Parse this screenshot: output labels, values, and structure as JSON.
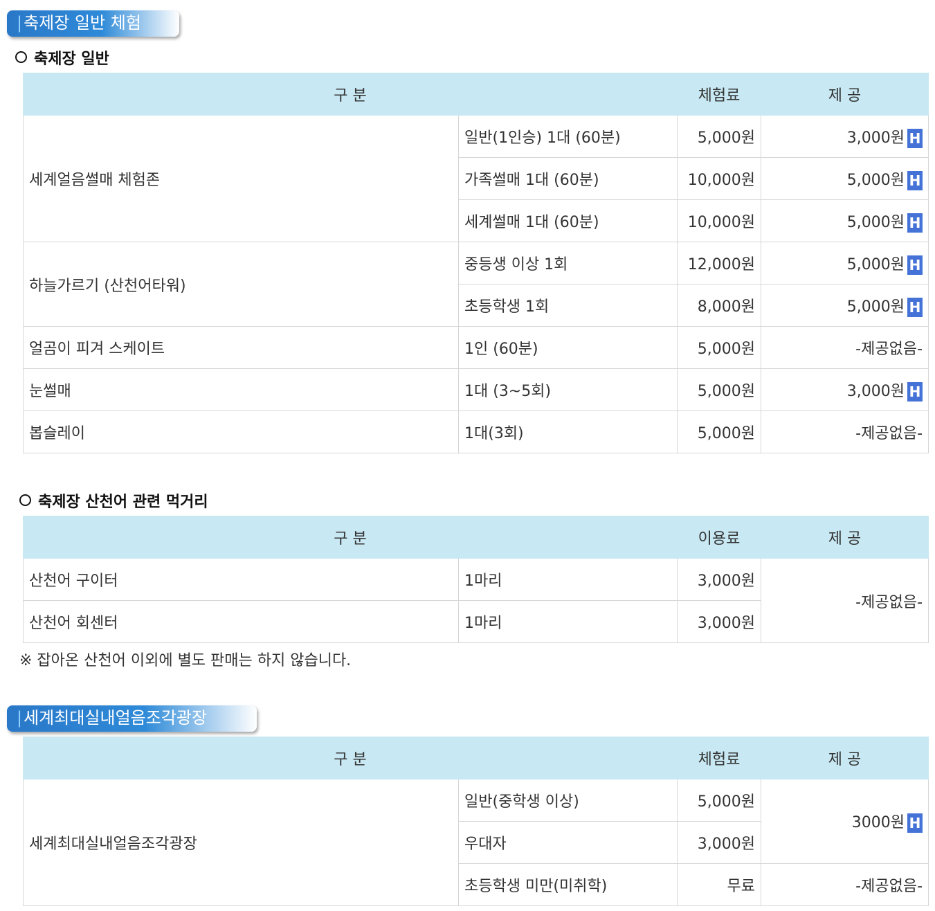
{
  "section1": {
    "tab_title": "축제장 일반 체험",
    "subtitle": "축제장 일반",
    "headers": [
      "구 분",
      "체험료",
      "제 공"
    ],
    "badge": "H",
    "rows": [
      {
        "name": "세계얼음썰매 체험존",
        "items": [
          {
            "desc": "일반(1인승) 1대 (60분)",
            "fee": "5,000원",
            "provide": "3,000원",
            "badge": true
          },
          {
            "desc": "가족썰매 1대 (60분)",
            "fee": "10,000원",
            "provide": "5,000원",
            "badge": true
          },
          {
            "desc": "세계썰매 1대 (60분)",
            "fee": "10,000원",
            "provide": "5,000원",
            "badge": true
          }
        ]
      },
      {
        "name": "하늘가르기 (산천어타워)",
        "items": [
          {
            "desc": "중등생 이상 1회",
            "fee": "12,000원",
            "provide": "5,000원",
            "badge": true
          },
          {
            "desc": "초등학생 1회",
            "fee": "8,000원",
            "provide": "5,000원",
            "badge": true
          }
        ]
      },
      {
        "name": "얼곰이 피겨 스케이트",
        "items": [
          {
            "desc": "1인 (60분)",
            "fee": "5,000원",
            "provide": "-제공없음-",
            "badge": false
          }
        ]
      },
      {
        "name": "눈썰매",
        "items": [
          {
            "desc": "1대 (3~5회)",
            "fee": "5,000원",
            "provide": "3,000원",
            "badge": true
          }
        ]
      },
      {
        "name": "봅슬레이",
        "items": [
          {
            "desc": "1대(3회)",
            "fee": "5,000원",
            "provide": "-제공없음-",
            "badge": false
          }
        ]
      }
    ]
  },
  "section2": {
    "subtitle": "축제장 산천어 관련 먹거리",
    "headers": [
      "구 분",
      "이용료",
      "제 공"
    ],
    "rows": [
      {
        "name": "산천어 구이터",
        "desc": "1마리",
        "fee": "3,000원"
      },
      {
        "name": "산천어 회센터",
        "desc": "1마리",
        "fee": "3,000원"
      }
    ],
    "provide": "-제공없음-",
    "note": "※ 잡아온 산천어 이외에 별도 판매는 하지 않습니다."
  },
  "section3": {
    "tab_title": "세계최대실내얼음조각광장",
    "headers": [
      "구 분",
      "체험료",
      "제 공"
    ],
    "name": "세계최대실내얼음조각광장",
    "rows": [
      {
        "desc": "일반(중학생 이상)",
        "fee": "5,000원"
      },
      {
        "desc": "우대자",
        "fee": "3,000원"
      },
      {
        "desc": "초등학생 미만(미취학)",
        "fee": "무료"
      }
    ],
    "provide_paid": "3000원",
    "provide_free": "-제공없음-"
  }
}
